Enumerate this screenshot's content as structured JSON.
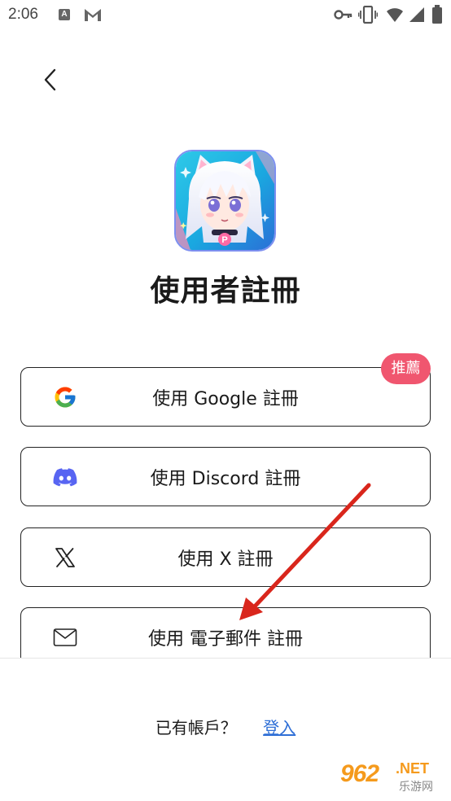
{
  "status_bar": {
    "time": "2:06",
    "notification_icons": [
      "a-icon",
      "gmail-icon"
    ],
    "system_icons": [
      "key-icon",
      "vibrate-icon",
      "wifi-icon",
      "signal-icon",
      "battery-icon"
    ],
    "a_letter": "A"
  },
  "header": {
    "back_icon": "chevron-left-icon",
    "title": "使用者註冊"
  },
  "signup_options": [
    {
      "label": "使用 Google 註冊",
      "icon": "google-icon",
      "badge": "推薦"
    },
    {
      "label": "使用 Discord 註冊",
      "icon": "discord-icon"
    },
    {
      "label": "使用 X 註冊",
      "icon": "x-icon"
    },
    {
      "label": "使用 電子郵件 註冊",
      "icon": "mail-icon"
    }
  ],
  "footer": {
    "prompt": "已有帳戶？",
    "login_link": "登入"
  },
  "watermark": {
    "logo_number": "962",
    "logo_suffix": ".NET",
    "logo_sub": "乐游网"
  },
  "colors": {
    "badge": "#f0566f",
    "link": "#2f6fd6",
    "annotation_arrow": "#d9261c",
    "discord": "#5865f2",
    "watermark": "#f59a1c"
  }
}
